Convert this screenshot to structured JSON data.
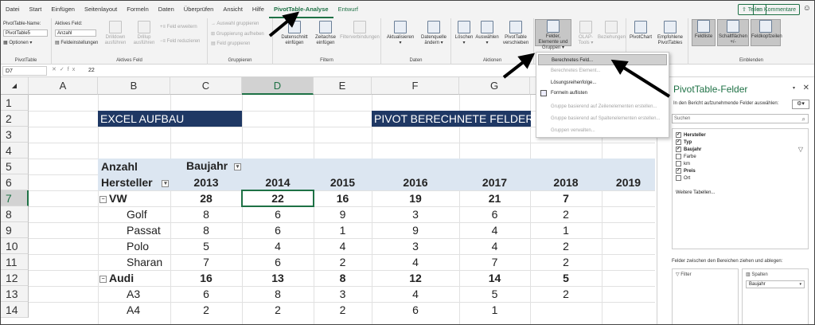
{
  "tabs": [
    "Datei",
    "Start",
    "Einfügen",
    "Seitenlayout",
    "Formeln",
    "Daten",
    "Überprüfen",
    "Ansicht",
    "Hilfe",
    "PivotTable-Analyse",
    "Entwurf"
  ],
  "topright": {
    "share": "Teilen",
    "comments": "Kommentare",
    "smiley_icon": "smiley-icon"
  },
  "ribbon": {
    "pivottable": {
      "name_label": "PivotTable-Name:",
      "name_value": "PivotTable5",
      "options": "Optionen",
      "group": "PivotTable"
    },
    "active_field": {
      "label": "Aktives Feld:",
      "value": "Anzahl",
      "settings": "Feldeinstellungen",
      "drilldown": "Drilldown ausführen",
      "drillup": "Drillup ausführen",
      "expand": "Feld erweitern",
      "collapse": "Feld reduzieren",
      "group": "Aktives Feld"
    },
    "grouping": {
      "sel": "Auswahl gruppieren",
      "ungroup": "Gruppierung aufheben",
      "field": "Feld gruppieren",
      "group": "Gruppieren"
    },
    "filter": {
      "slicer": "Datenschnitt einfügen",
      "timeline": "Zeitachse einfügen",
      "connections": "Filterverbindungen",
      "group": "Filtern"
    },
    "data": {
      "refresh": "Aktualisieren",
      "source": "Datenquelle ändern",
      "group": "Daten"
    },
    "actions": {
      "clear": "Löschen",
      "select": "Auswählen",
      "move": "PivotTable verschieben",
      "group": "Aktionen"
    },
    "calc": {
      "fields": "Felder, Elemente und Gruppen",
      "olap": "OLAP-Tools",
      "relations": "Beziehungen"
    },
    "tools": {
      "chart": "PivotChart",
      "recommended": "Empfohlene PivotTables"
    },
    "show": {
      "fieldlist": "Feldliste",
      "buttons": "Schaltflächen +/-",
      "headers": "Feldkopfzeilen",
      "group": "Einblenden"
    }
  },
  "formula_bar": {
    "cell_ref": "D7",
    "value": "22"
  },
  "columns": [
    "A",
    "B",
    "C",
    "D",
    "E",
    "F",
    "G",
    "H",
    "I"
  ],
  "rows": [
    "1",
    "2",
    "3",
    "4",
    "5",
    "6",
    "7",
    "8",
    "9",
    "10",
    "11",
    "12",
    "13",
    "14"
  ],
  "banners": {
    "left": "EXCEL AUFBAU",
    "right": "PIVOT BERECHNETE FELDER"
  },
  "pivot": {
    "value_label": "Anzahl",
    "col_field": "Baujahr",
    "row_field": "Hersteller",
    "years": [
      "2013",
      "2014",
      "2015",
      "2016",
      "2017",
      "2018",
      "2019"
    ],
    "rows": [
      {
        "label": "VW",
        "bold": true,
        "values": [
          "28",
          "22",
          "16",
          "19",
          "21",
          "7",
          ""
        ]
      },
      {
        "label": "Golf",
        "bold": false,
        "values": [
          "8",
          "6",
          "9",
          "3",
          "6",
          "2",
          ""
        ]
      },
      {
        "label": "Passat",
        "bold": false,
        "values": [
          "8",
          "6",
          "1",
          "9",
          "4",
          "1",
          ""
        ]
      },
      {
        "label": "Polo",
        "bold": false,
        "values": [
          "5",
          "4",
          "4",
          "3",
          "4",
          "2",
          ""
        ]
      },
      {
        "label": "Sharan",
        "bold": false,
        "values": [
          "7",
          "6",
          "2",
          "4",
          "7",
          "2",
          ""
        ]
      },
      {
        "label": "Audi",
        "bold": true,
        "values": [
          "16",
          "13",
          "8",
          "12",
          "14",
          "5",
          ""
        ]
      },
      {
        "label": "A3",
        "bold": false,
        "values": [
          "6",
          "8",
          "3",
          "4",
          "5",
          "2",
          ""
        ]
      },
      {
        "label": "A4",
        "bold": false,
        "values": [
          "2",
          "2",
          "2",
          "6",
          "1",
          "",
          ""
        ]
      }
    ]
  },
  "menu": {
    "items": [
      {
        "label": "Berechnetes Feld...",
        "state": "highlight"
      },
      {
        "label": "Berechnetes Element...",
        "state": "disabled"
      },
      {
        "label": "Lösungsreihenfolge...",
        "state": "enabled"
      },
      {
        "label": "Formeln auflisten",
        "state": "enabled"
      },
      {
        "label": "Gruppe basierend auf Zeilenelementen erstellen...",
        "state": "disabled"
      },
      {
        "label": "Gruppe basierend auf Spaltenelementen erstellen...",
        "state": "disabled"
      },
      {
        "label": "Gruppen verwalten...",
        "state": "disabled"
      }
    ]
  },
  "pane": {
    "title": "PivotTable-Felder",
    "subtitle": "In den Bericht aufzunehmende Felder auswählen:",
    "search_placeholder": "Suchen",
    "fields": [
      {
        "name": "Hersteller",
        "checked": true
      },
      {
        "name": "Typ",
        "checked": true
      },
      {
        "name": "Baujahr",
        "checked": true
      },
      {
        "name": "Farbe",
        "checked": false
      },
      {
        "name": "km",
        "checked": false
      },
      {
        "name": "Preis",
        "checked": true
      },
      {
        "name": "Ort",
        "checked": false
      }
    ],
    "more_tables": "Weitere Tabellen...",
    "drag_msg": "Felder zwischen den Bereichen ziehen und ablegen:",
    "filter_label": "Filter",
    "columns_label": "Spalten",
    "columns_chip": "Baujahr"
  }
}
